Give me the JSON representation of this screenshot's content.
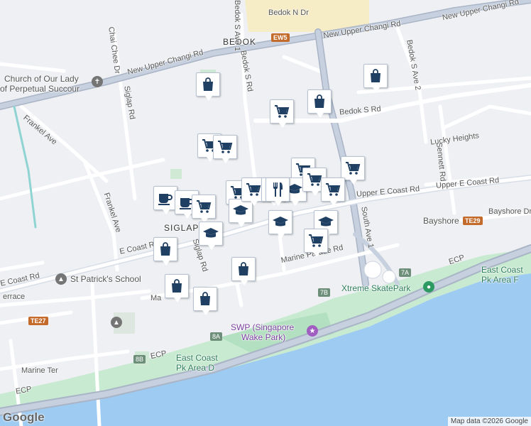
{
  "map": {
    "road_labels": {
      "new_upper_changi_1": "New Upper Changi Rd",
      "new_upper_changi_2": "New Upper Changi Rd",
      "new_upper_changi_3": "New Upper Changi Rd",
      "bedok_n_dr": "Bedok N Dr",
      "bedok_s_rd": "Bedok S Rd",
      "bedok_s_rd_2": "Bedok S Rd",
      "bedok_s_ave_1": "Bedok S Ave 1",
      "bedok_s_ave_2": "Bedok S Ave 2",
      "chai_chee_dr": "Chai Chee Dr",
      "siglap_rd": "Siglap Rd",
      "siglap_rd_2": "Siglap Rd",
      "frankel_ave": "Frankel Ave",
      "frankel_ave_2": "Frankel Ave",
      "sennett_rd": "Sennett Rd",
      "lucky_heights": "Lucky Heights",
      "upper_e_coast_1": "Upper E Coast Rd",
      "upper_e_coast_2": "Upper E Coast Rd",
      "e_coast_rd_1": "E Coast Rd",
      "e_coast_rd_2": "E Coast Rd",
      "bayshore_dr": "Bayshore Dr",
      "marine_parade_rd": "Marine Parade Rd",
      "marine_ter": "Marine Ter",
      "south_ave_1": "South Ave 1",
      "ecp_1": "ECP",
      "ecp_2": "ECP",
      "ecp_3": "ECP",
      "area_lbl_bedok": "BEDOK",
      "area_lbl_siglap": "SIGLAP",
      "terrace": "errace",
      "marine_partial": "Ma"
    },
    "pois": {
      "church_line1": "Church of Our Lady",
      "church_line2": "of Perpetual Succour",
      "st_patricks": "St Patrick's School",
      "xtreme": "Xtreme SkatePark",
      "swp_line1": "SWP (Singapore",
      "swp_line2": "Wake Park)",
      "ecp_area_d_line1": "East Coast",
      "ecp_area_d_line2": "Pk Area D",
      "ecp_area_f_line1": "East Coast",
      "ecp_area_f_line2": "Pk Area F",
      "bayshore": "Bayshore"
    },
    "badges": {
      "ew5": "EW5",
      "te29": "TE29",
      "te27": "TE27",
      "exit_7a": "7A",
      "exit_7b": "7B",
      "exit_8a": "8A",
      "exit_8b": "8B"
    },
    "markers": [
      {
        "icon": "shopping-bag-icon"
      },
      {
        "icon": "shopping-bag-icon"
      },
      {
        "icon": "shopping-cart-icon"
      },
      {
        "icon": "shopping-bag-icon"
      },
      {
        "icon": "shopping-cart-icon"
      },
      {
        "icon": "shopping-cart-icon"
      },
      {
        "icon": "shopping-cart-icon"
      },
      {
        "icon": "shopping-cart-icon"
      },
      {
        "icon": "coffee-cup-icon"
      },
      {
        "icon": "coffee-cup-icon"
      },
      {
        "icon": "shopping-cart-icon"
      },
      {
        "icon": "shopping-cart-icon"
      },
      {
        "icon": "graduation-cap-icon"
      },
      {
        "icon": "graduation-cap-icon"
      },
      {
        "icon": "shopping-cart-icon"
      },
      {
        "icon": "fork-knife-icon"
      },
      {
        "icon": "graduation-cap-icon"
      },
      {
        "icon": "fork-knife-icon"
      },
      {
        "icon": "graduation-cap-icon"
      },
      {
        "icon": "shopping-cart-icon"
      },
      {
        "icon": "shopping-cart-icon"
      },
      {
        "icon": "graduation-cap-icon"
      },
      {
        "icon": "shopping-cart-icon"
      },
      {
        "icon": "shopping-bag-icon"
      },
      {
        "icon": "shopping-bag-icon"
      },
      {
        "icon": "shopping-bag-icon"
      },
      {
        "icon": "shopping-bag-icon"
      }
    ],
    "google_logo": "Google",
    "attribution": "Map data ©2026 Google"
  }
}
